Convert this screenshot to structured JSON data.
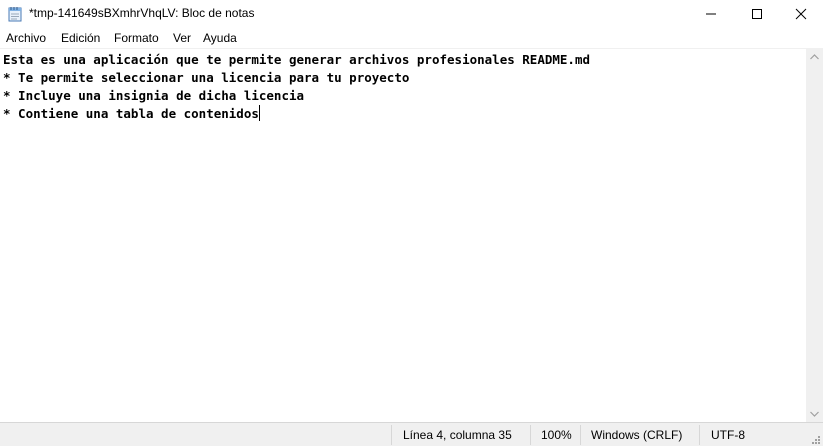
{
  "window": {
    "title": "*tmp-141649sBXmhrVhqLV: Bloc de notas",
    "icon": "notepad-icon"
  },
  "menu": {
    "items": [
      "Archivo",
      "Edición",
      "Formato",
      "Ver",
      "Ayuda"
    ]
  },
  "editor": {
    "lines": [
      "Esta es una aplicación que te permite generar archivos profesionales README.md",
      "* Te permite seleccionar una licencia para tu proyecto",
      "* Incluye una insignia de dicha licencia",
      "* Contiene una tabla de contenidos"
    ]
  },
  "status": {
    "position": "Línea 4, columna 35",
    "zoom": "100%",
    "line_endings": "Windows (CRLF)",
    "encoding": "UTF-8"
  },
  "colors": {
    "background": "#ffffff",
    "statusbar": "#f0f0f0",
    "text": "#000000"
  }
}
